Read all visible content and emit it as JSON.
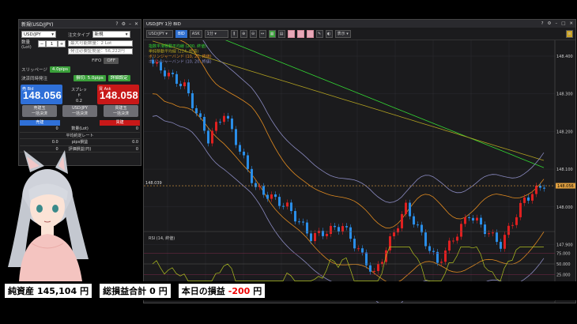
{
  "order_panel": {
    "title": "新規(USD/JPY)",
    "pair": "USD/JPY",
    "order_type_label": "注文タイプ",
    "order_type": "新規",
    "qty_label": "数量",
    "qty_unit": "(Lot)",
    "qty_value": "1",
    "max_order": "最大可能数量：2 Lot",
    "margin_note": "発注必要証拠金：56,222円",
    "fifo_label": "FIFO",
    "fifo_value": "OFF",
    "slippage_label": "スリッページ",
    "slippage_value": "4.0pips",
    "settle_label": "決済同時発注",
    "spread_label": "スプレッド",
    "spread_value": "0.2",
    "sell_tag": "売 Bid",
    "sell_price": "148.056",
    "buy_tag": "買 Ask",
    "buy_price": "148.058",
    "profit_btn": "損切: 5.0pips",
    "detail_btn": "詳細設定",
    "btn_sell_close": "売建玉\n一括決済",
    "btn_all_close": "USD/JPY\n一括決済",
    "btn_buy_close": "買建玉\n一括決済",
    "col_sell": "売建",
    "col_buy": "買建",
    "rows": [
      {
        "l": "0",
        "m": "数量(Lot)",
        "r": "0"
      },
      {
        "l": "",
        "m": "平均約定レート",
        "r": ""
      },
      {
        "l": "0.0",
        "m": "pips損益",
        "r": "0.0"
      },
      {
        "l": "0",
        "m": "評価損益(円)",
        "r": "0"
      }
    ]
  },
  "chart": {
    "title": "USD/JPY 1分 BID",
    "pair": "USD/JPY",
    "bid": "BID",
    "ask": "ASK",
    "timeframe": "1分",
    "display_btn": "表示",
    "legend": [
      "指数平滑移動平均線 (200, 終値)",
      "単純移動平均線 (224, 終値)",
      "ボリンジャーバンド (10, 20, 終値)",
      "ボリンジャーバンド (10, 20, 終値)"
    ],
    "price_left": "148.039",
    "price_tag": "148.056",
    "y_ticks": [
      "148.400",
      "148.300",
      "148.200",
      "148.100",
      "148.000",
      "147.900"
    ],
    "x_ticks": [
      "17:07",
      "17:17",
      "17:27",
      "17:37",
      "17:47",
      "17:57",
      "18:07",
      "18:17",
      "18:27",
      "18:37"
    ],
    "rsi_label": "RSI (14, 終値)",
    "rsi_ticks": [
      "75.000",
      "50.000",
      "25.000"
    ]
  },
  "stats": {
    "assets_label": "純資産",
    "assets_value": "145,104",
    "assets_unit": "円",
    "total_label": "総損益合計",
    "total_value": "0",
    "total_unit": "円",
    "today_label": "本日の損益",
    "today_value": "-200",
    "today_unit": "円"
  },
  "colors": {
    "up": "#e02020",
    "down": "#2a8ee8",
    "ema200": "#33d633",
    "sma224": "#b0a020",
    "bb_a": "#e08a20",
    "bb_b": "#8a8ac0"
  }
}
